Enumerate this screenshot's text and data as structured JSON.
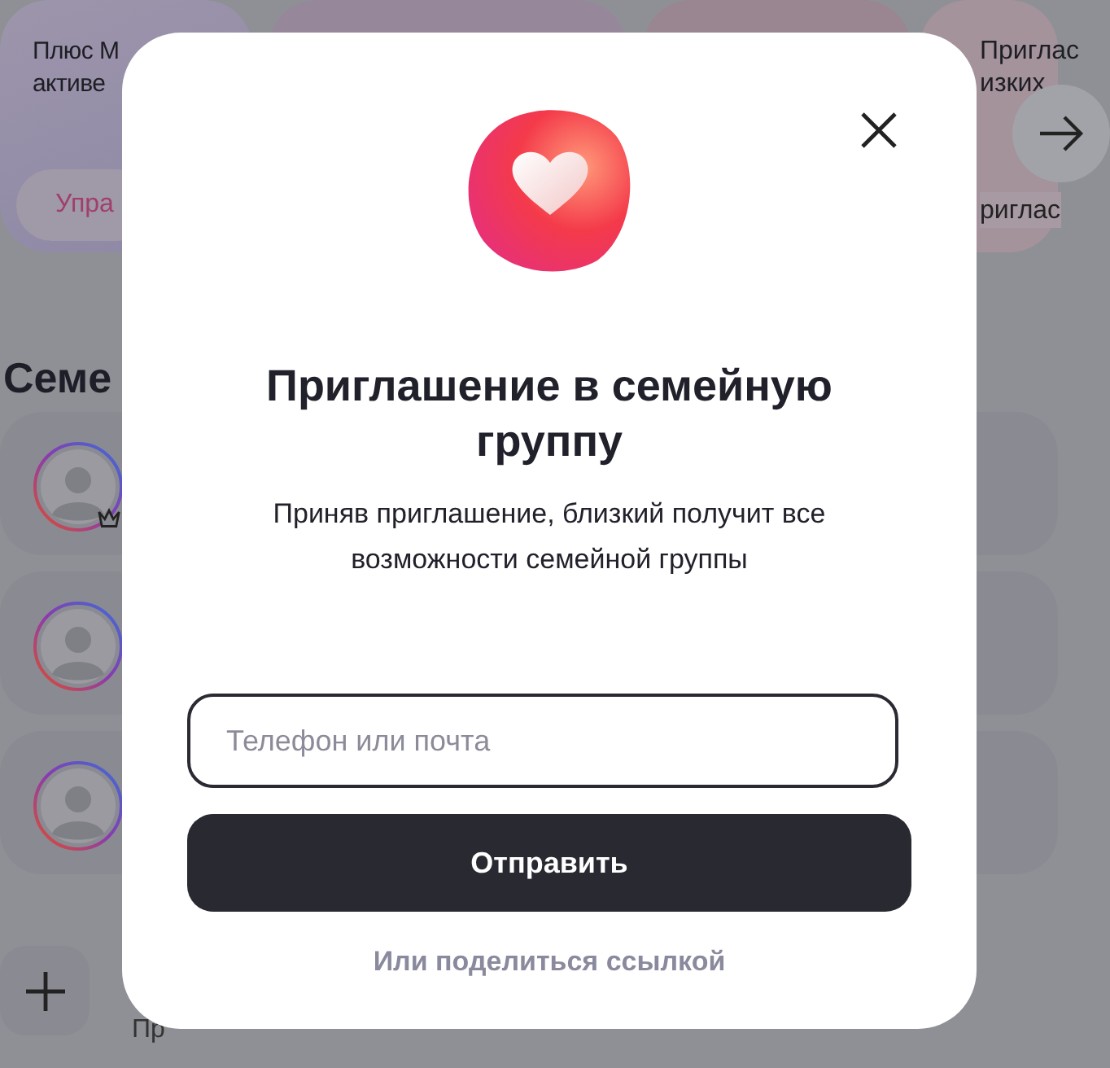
{
  "background": {
    "cards": [
      {
        "title_lines": [
          "Плюс М",
          "активе"
        ],
        "button": "Упра"
      },
      {
        "title_lines": [
          "Приглас",
          "изких"
        ],
        "button": "риглас"
      }
    ],
    "section_title": "Семе",
    "members": [
      {
        "badge": true
      },
      {
        "badge": false
      },
      {
        "badge": false
      }
    ],
    "add_label": "Пр"
  },
  "dialog": {
    "title": "Приглашение в семейную группу",
    "text": "Приняв приглашение, близкий получит все возможности семейной группы",
    "field": {
      "placeholder": "Телефон или почта"
    },
    "submit": "Отправить",
    "share_link": "Или поделиться ссылкой"
  }
}
